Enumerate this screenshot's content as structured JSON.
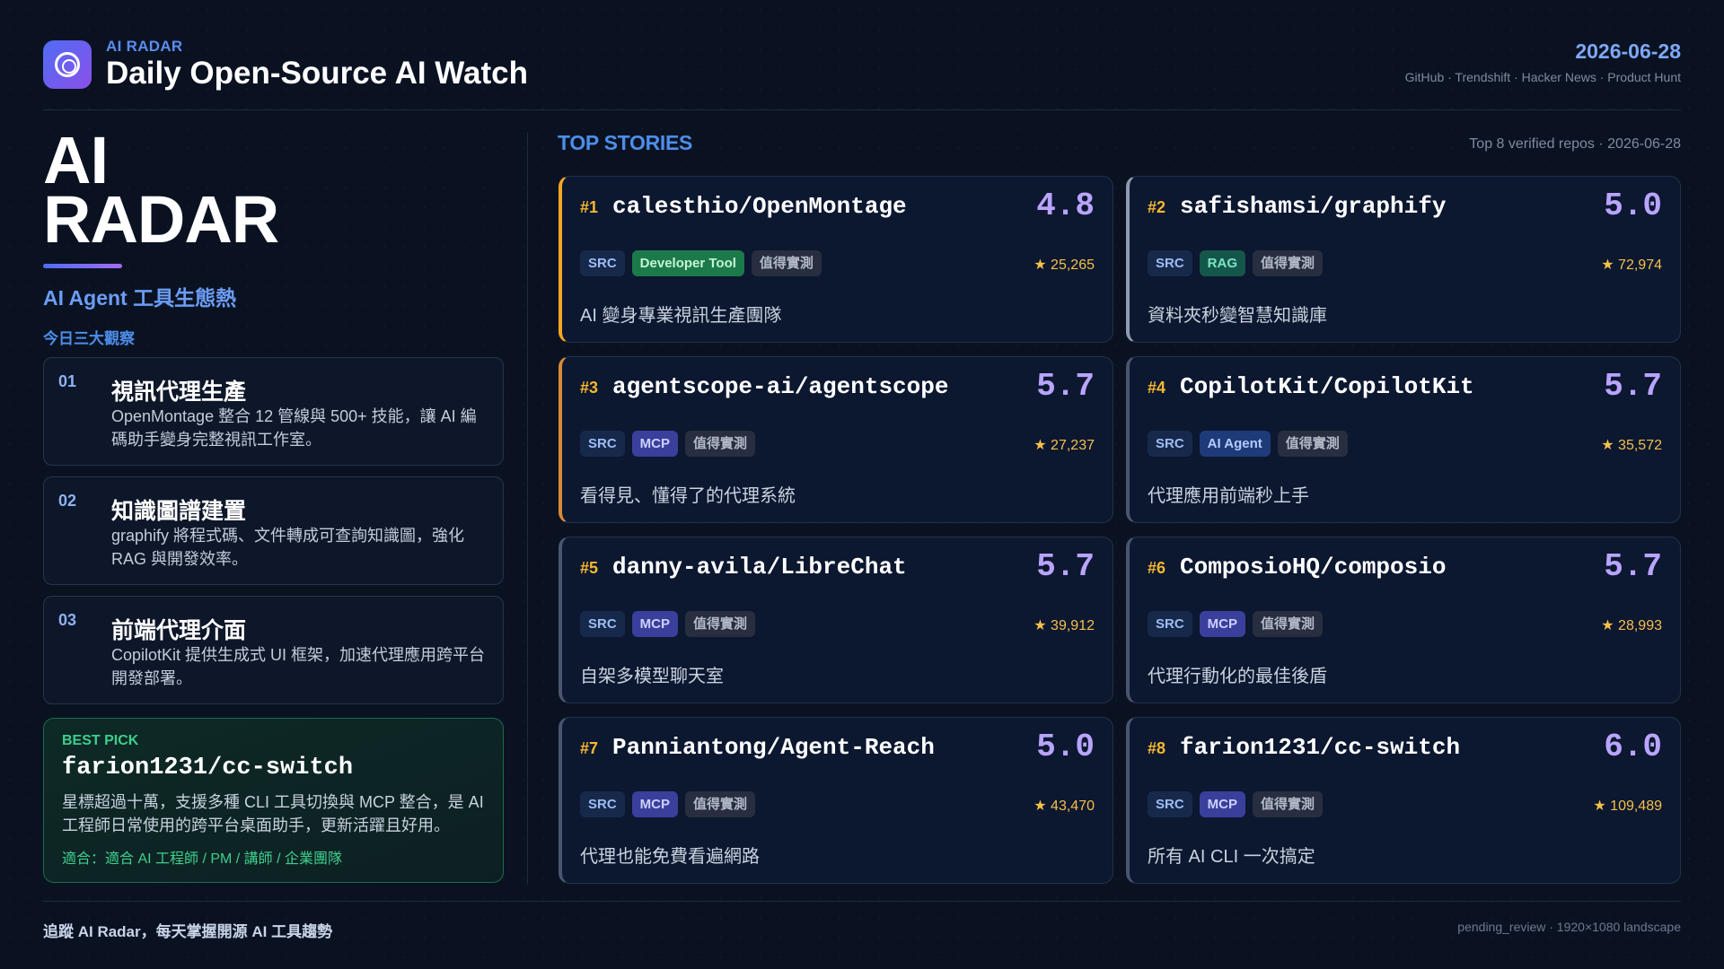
{
  "header": {
    "brand_small": "AI RADAR",
    "title": "Daily Open-Source AI Watch",
    "date": "2026-06-28",
    "sources": "GitHub · Trendshift · Hacker News · Product Hunt",
    "logo_icon": "radar-target-icon"
  },
  "left": {
    "big_title_line1": "AI",
    "big_title_line2": "RADAR",
    "subtitle": "AI Agent 工具生態熱",
    "observations_label": "今日三大觀察",
    "observations": [
      {
        "num": "01",
        "title": "視訊代理生產",
        "desc": "OpenMontage 整合 12 管線與 500+ 技能，讓 AI 編碼助手變身完整視訊工作室。"
      },
      {
        "num": "02",
        "title": "知識圖譜建置",
        "desc": "graphify 將程式碼、文件轉成可查詢知識圖，強化 RAG 與開發效率。"
      },
      {
        "num": "03",
        "title": "前端代理介面",
        "desc": "CopilotKit 提供生成式 UI 框架，加速代理應用跨平台開發部署。"
      }
    ],
    "best_pick": {
      "label": "BEST PICK",
      "repo": "farion1231/cc-switch",
      "desc": "星標超過十萬，支援多種 CLI 工具切換與 MCP 整合，是 AI 工程師日常使用的跨平台桌面助手，更新活躍且好用。",
      "fit": "適合：適合 AI 工程師 / PM / 講師 / 企業團隊"
    }
  },
  "top_stories": {
    "label": "TOP STORIES",
    "meta": "Top 8 verified repos · 2026-06-28",
    "star_icon": "star-icon",
    "cards": [
      {
        "rank": "#1",
        "repo": "calesthio/OpenMontage",
        "score": "4.8",
        "tags": [
          "SRC",
          "Developer Tool",
          "值得實測"
        ],
        "stars": "★ 25,265",
        "desc": "AI 變身專業視訊生產團隊",
        "medal": "gold"
      },
      {
        "rank": "#2",
        "repo": "safishamsi/graphify",
        "score": "5.0",
        "tags": [
          "SRC",
          "RAG",
          "值得實測"
        ],
        "stars": "★ 72,974",
        "desc": "資料夾秒變智慧知識庫",
        "medal": "silver"
      },
      {
        "rank": "#3",
        "repo": "agentscope-ai/agentscope",
        "score": "5.7",
        "tags": [
          "SRC",
          "MCP",
          "值得實測"
        ],
        "stars": "★ 27,237",
        "desc": "看得見、懂得了的代理系統",
        "medal": "bronze"
      },
      {
        "rank": "#4",
        "repo": "CopilotKit/CopilotKit",
        "score": "5.7",
        "tags": [
          "SRC",
          "AI Agent",
          "值得實測"
        ],
        "stars": "★ 35,572",
        "desc": "代理應用前端秒上手",
        "medal": "none"
      },
      {
        "rank": "#5",
        "repo": "danny-avila/LibreChat",
        "score": "5.7",
        "tags": [
          "SRC",
          "MCP",
          "值得實測"
        ],
        "stars": "★ 39,912",
        "desc": "自架多模型聊天室",
        "medal": "none"
      },
      {
        "rank": "#6",
        "repo": "ComposioHQ/composio",
        "score": "5.7",
        "tags": [
          "SRC",
          "MCP",
          "值得實測"
        ],
        "stars": "★ 28,993",
        "desc": "代理行動化的最佳後盾",
        "medal": "none"
      },
      {
        "rank": "#7",
        "repo": "Panniantong/Agent-Reach",
        "score": "5.0",
        "tags": [
          "SRC",
          "MCP",
          "值得實測"
        ],
        "stars": "★ 43,470",
        "desc": "代理也能免費看遍網路",
        "medal": "none"
      },
      {
        "rank": "#8",
        "repo": "farion1231/cc-switch",
        "score": "6.0",
        "tags": [
          "SRC",
          "MCP",
          "值得實測"
        ],
        "stars": "★ 109,489",
        "desc": "所有 AI CLI 一次搞定",
        "medal": "none"
      }
    ]
  },
  "footer": {
    "left": "追蹤 AI Radar，每天掌握開源 AI 工具趨勢",
    "right": "pending_review · 1920×1080 landscape"
  }
}
